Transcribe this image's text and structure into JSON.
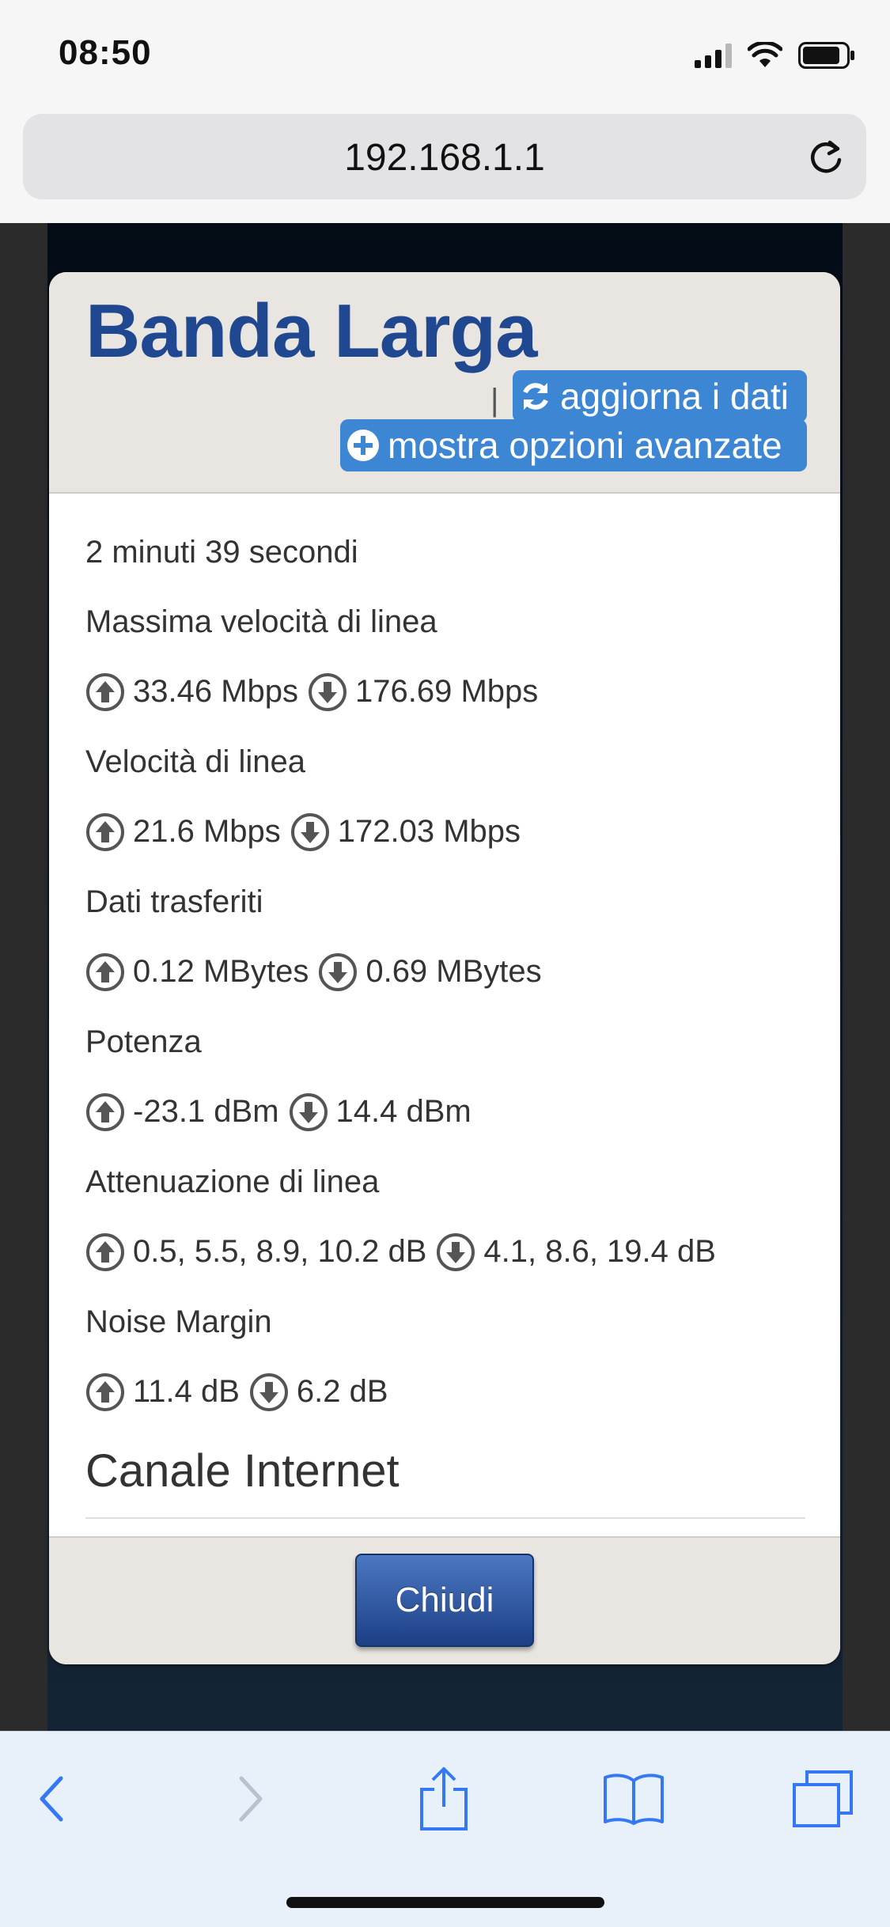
{
  "status_bar": {
    "time": "08:50"
  },
  "browser": {
    "url": "192.168.1.1"
  },
  "modal": {
    "title": "Banda Larga",
    "separator": "|",
    "refresh_label": "aggiorna i dati",
    "advanced_label": "mostra opzioni avanzate",
    "uptime": "2 minuti 39 secondi",
    "max_line_speed": {
      "label": "Massima velocità di linea",
      "up": "33.46 Mbps",
      "down": "176.69 Mbps"
    },
    "line_speed": {
      "label": "Velocità di linea",
      "up": "21.6 Mbps",
      "down": "172.03 Mbps"
    },
    "data_transferred": {
      "label": "Dati trasferiti",
      "up": "0.12 MBytes",
      "down": "0.69 MBytes"
    },
    "power": {
      "label": "Potenza",
      "up": "-23.1 dBm",
      "down": "14.4 dBm"
    },
    "attenuation": {
      "label": "Attenuazione di linea",
      "up": "0.5, 5.5, 8.9, 10.2 dB",
      "down": "4.1, 8.6, 19.4 dB"
    },
    "noise_margin": {
      "label": "Noise Margin",
      "up": "11.4 dB",
      "down": "6.2 dB"
    },
    "section_title": "Canale Internet",
    "close_label": "Chiudi"
  },
  "colors": {
    "title_blue": "#1f4891",
    "link_button_blue": "#3d86d4",
    "close_button_blue": "#2a5aa8",
    "ios_tint": "#3478f6"
  },
  "icons": {
    "up": "arrow-up-circle-icon",
    "down": "arrow-down-circle-icon",
    "refresh": "refresh-icon",
    "plus": "plus-circle-icon"
  }
}
